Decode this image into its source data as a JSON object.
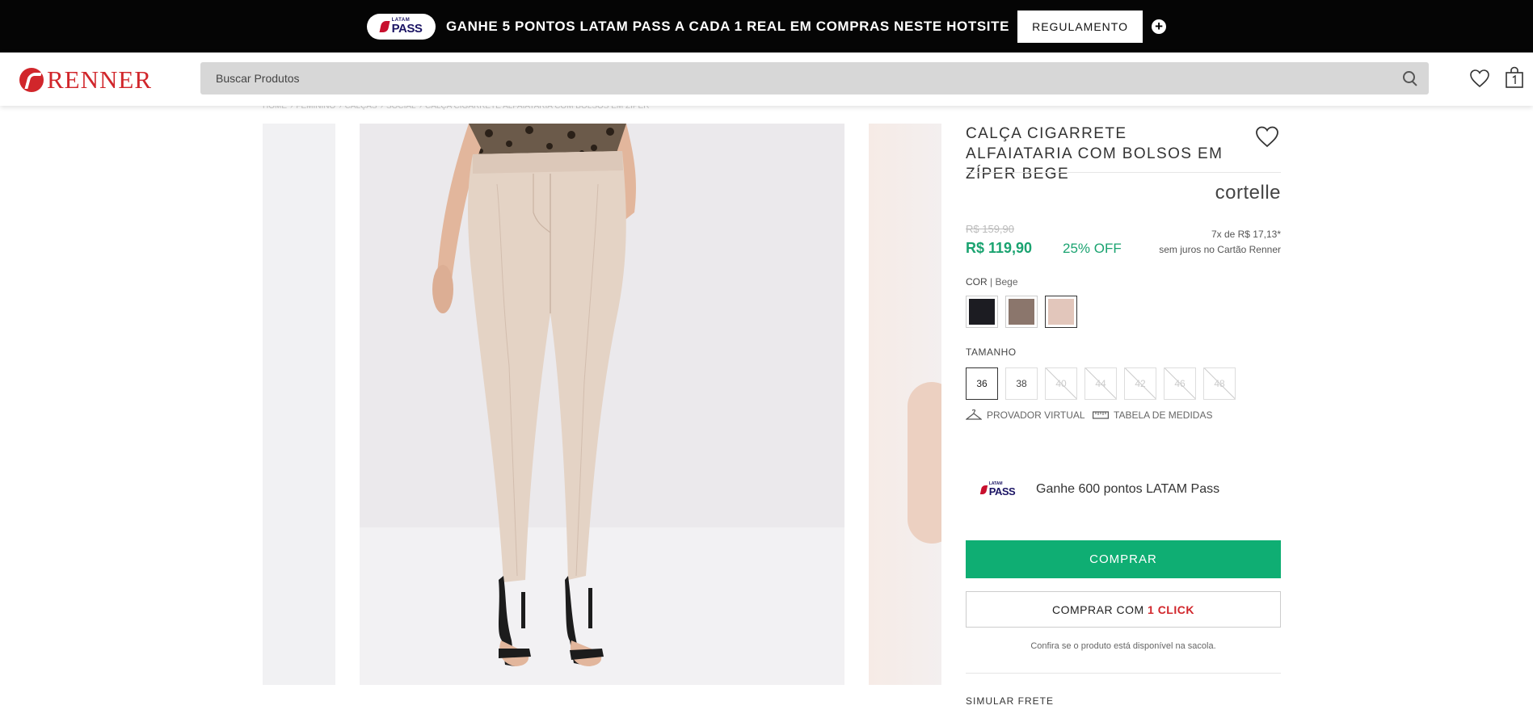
{
  "promo": {
    "latam_small": "LATAM",
    "latam_big": "PASS",
    "text": "GANHE 5 PONTOS LATAM PASS A CADA 1 REAL EM COMPRAS NESTE HOTSITE",
    "button": "REGULAMENTO",
    "plus": "+"
  },
  "header": {
    "logo": "RENNER",
    "search_placeholder": "Buscar Produtos"
  },
  "breadcrumb": [
    "HOME",
    "FEMININO",
    "CALÇAS",
    "SOCIAL",
    "CALÇA CIGARRETE ALFAIATARIA COM BOLSOS EM ZÍPER"
  ],
  "product": {
    "title": "CALÇA CIGARRETE ALFAIATARIA COM BOLSOS EM ZÍPER BEGE",
    "brand": "cortelle",
    "old_price": "R$ 159,90",
    "price": "R$ 119,90",
    "discount": "25% OFF",
    "installments": "7x de R$ 17,13*",
    "installments_note": "sem juros no Cartão Renner",
    "color_label": "COR",
    "color_value": "| Bege",
    "colors": [
      {
        "name": "preto",
        "hex": "#1c1c22",
        "selected": false
      },
      {
        "name": "marrom",
        "hex": "#8b766c",
        "selected": false
      },
      {
        "name": "bege",
        "hex": "#e2c6bb",
        "selected": true
      }
    ],
    "size_label": "TAMANHO",
    "sizes": [
      {
        "label": "36",
        "state": "selected"
      },
      {
        "label": "38",
        "state": "available"
      },
      {
        "label": "40",
        "state": "unavailable"
      },
      {
        "label": "44",
        "state": "unavailable"
      },
      {
        "label": "42",
        "state": "unavailable"
      },
      {
        "label": "46",
        "state": "unavailable"
      },
      {
        "label": "48",
        "state": "unavailable"
      }
    ],
    "virtual_fitting": "PROVADOR VIRTUAL",
    "size_chart": "TABELA DE MEDIDAS",
    "latam_small": "LATAM",
    "latam_big": "PASS",
    "latam_points": "Ganhe 600 pontos LATAM Pass",
    "buy_button": "COMPRAR",
    "one_click_prefix": "COMPRAR COM ",
    "one_click_highlight": "1 CLICK",
    "availability_note": "Confira se o produto está disponível na sacola.",
    "shipping": "SIMULAR FRETE"
  },
  "colors": {
    "brand_red": "#d1262b",
    "buy_green": "#0fae73",
    "price_green": "#1aa370",
    "pants": "#e4d3c5"
  }
}
